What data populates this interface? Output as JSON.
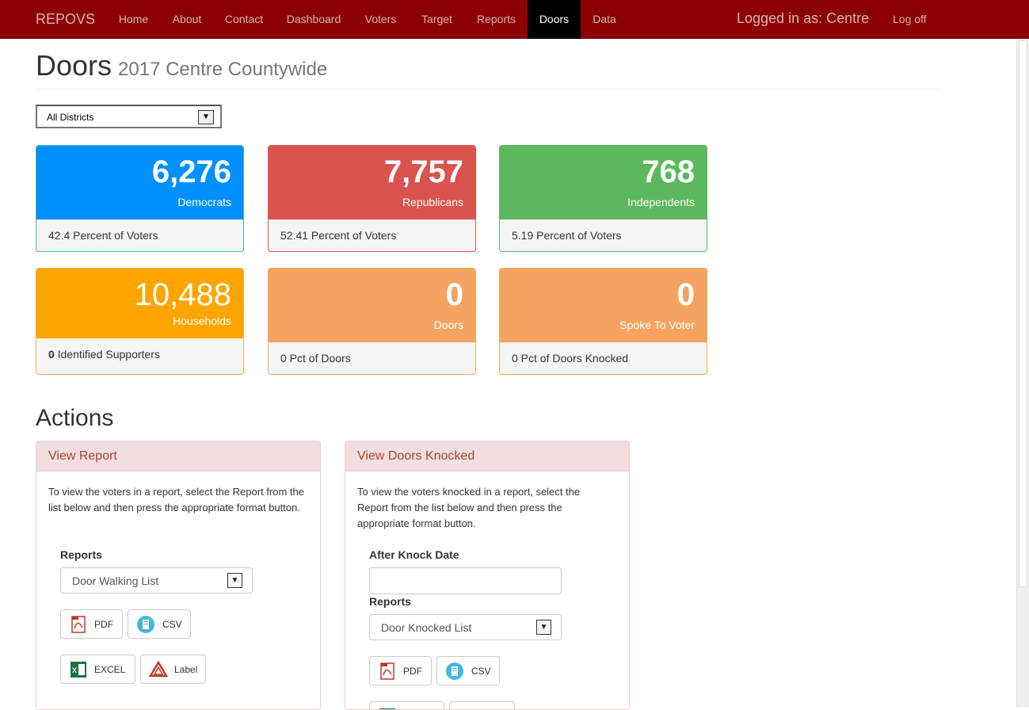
{
  "nav": {
    "brand": "REPOVS",
    "items": [
      "Home",
      "About",
      "Contact",
      "Dashboard",
      "Voters",
      "Target",
      "Reports",
      "Doors",
      "Data"
    ],
    "active": "Doors",
    "logged_in": "Logged in as: Centre",
    "logoff": "Log off"
  },
  "page": {
    "title": "Doors",
    "subtitle": "2017 Centre Countywide"
  },
  "district_select": {
    "value": "All Districts"
  },
  "cards": [
    {
      "number": "6,276",
      "label": "Democrats",
      "footer": "42.4 Percent of Voters",
      "color": "#0090ff",
      "border": "#45b5c4"
    },
    {
      "number": "7,757",
      "label": "Republicans",
      "footer": "52.41 Percent of Voters",
      "color": "#d9534f",
      "border": "#d9534f"
    },
    {
      "number": "768",
      "label": "Independents",
      "footer": "5.19 Percent of Voters",
      "color": "#5cb85c",
      "border": "#5cb85c"
    },
    {
      "number": "10,488",
      "label": "Households",
      "footer_bold": "0",
      "footer": "Identified Supporters",
      "color": "#ffa500",
      "border": "#f0ad4e"
    },
    {
      "number": "0",
      "label": "Doors",
      "footer": "0 Pct of Doors",
      "color": "#f4a460",
      "border": "#f0ad4e"
    },
    {
      "number": "0",
      "label": "Spoke To Voter",
      "footer": "0 Pct of Doors Knocked",
      "color": "#f4a460",
      "border": "#f0ad4e"
    }
  ],
  "actions": {
    "title": "Actions",
    "view_report": {
      "heading": "View Report",
      "text": "To view the voters in a report, select the Report from the list below and then press the appropriate format button.",
      "reports_label": "Reports",
      "reports_value": "Door Walking List",
      "pdf_label": "PDF",
      "csv_label": "CSV",
      "excel_label": "EXCEL",
      "label_label": "Label"
    },
    "view_doors": {
      "heading": "View Doors Knocked",
      "text": "To view the voters knocked in a report, select the Report from the list below and then press the appropriate format button.",
      "date_label": "After Knock Date",
      "date_value": "",
      "reports_label": "Reports",
      "reports_value": "Door Knocked List",
      "pdf_label": "PDF",
      "csv_label": "CSV"
    }
  },
  "icons": {
    "pdf": "pdf-icon",
    "csv": "csv-icon",
    "excel": "excel-icon",
    "label": "label-icon",
    "dropdown": "chevron-down-icon"
  }
}
